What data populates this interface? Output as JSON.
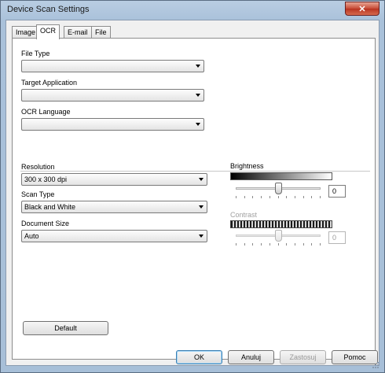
{
  "window": {
    "title": "Device Scan Settings",
    "close_label": "✕"
  },
  "tabs": [
    {
      "label": "Image",
      "active": false
    },
    {
      "label": "OCR",
      "active": true
    },
    {
      "label": "E-mail",
      "active": false
    },
    {
      "label": "File",
      "active": false
    }
  ],
  "ocr": {
    "file_type_label": "File Type",
    "file_type_value": "",
    "target_app_label": "Target Application",
    "target_app_value": "",
    "ocr_language_label": "OCR Language",
    "ocr_language_value": ""
  },
  "scan": {
    "resolution_label": "Resolution",
    "resolution_value": "300 x 300 dpi",
    "scan_type_label": "Scan Type",
    "scan_type_value": "Black and White",
    "document_size_label": "Document Size",
    "document_size_value": "Auto"
  },
  "brightness": {
    "label": "Brightness",
    "value": "0",
    "level": 0.5,
    "enabled": true
  },
  "contrast": {
    "label": "Contrast",
    "value": "0",
    "level": 0.5,
    "enabled": false
  },
  "buttons": {
    "default": "Default",
    "ok": "OK",
    "cancel": "Anuluj",
    "apply": "Zastosuj",
    "help": "Pomoc"
  }
}
